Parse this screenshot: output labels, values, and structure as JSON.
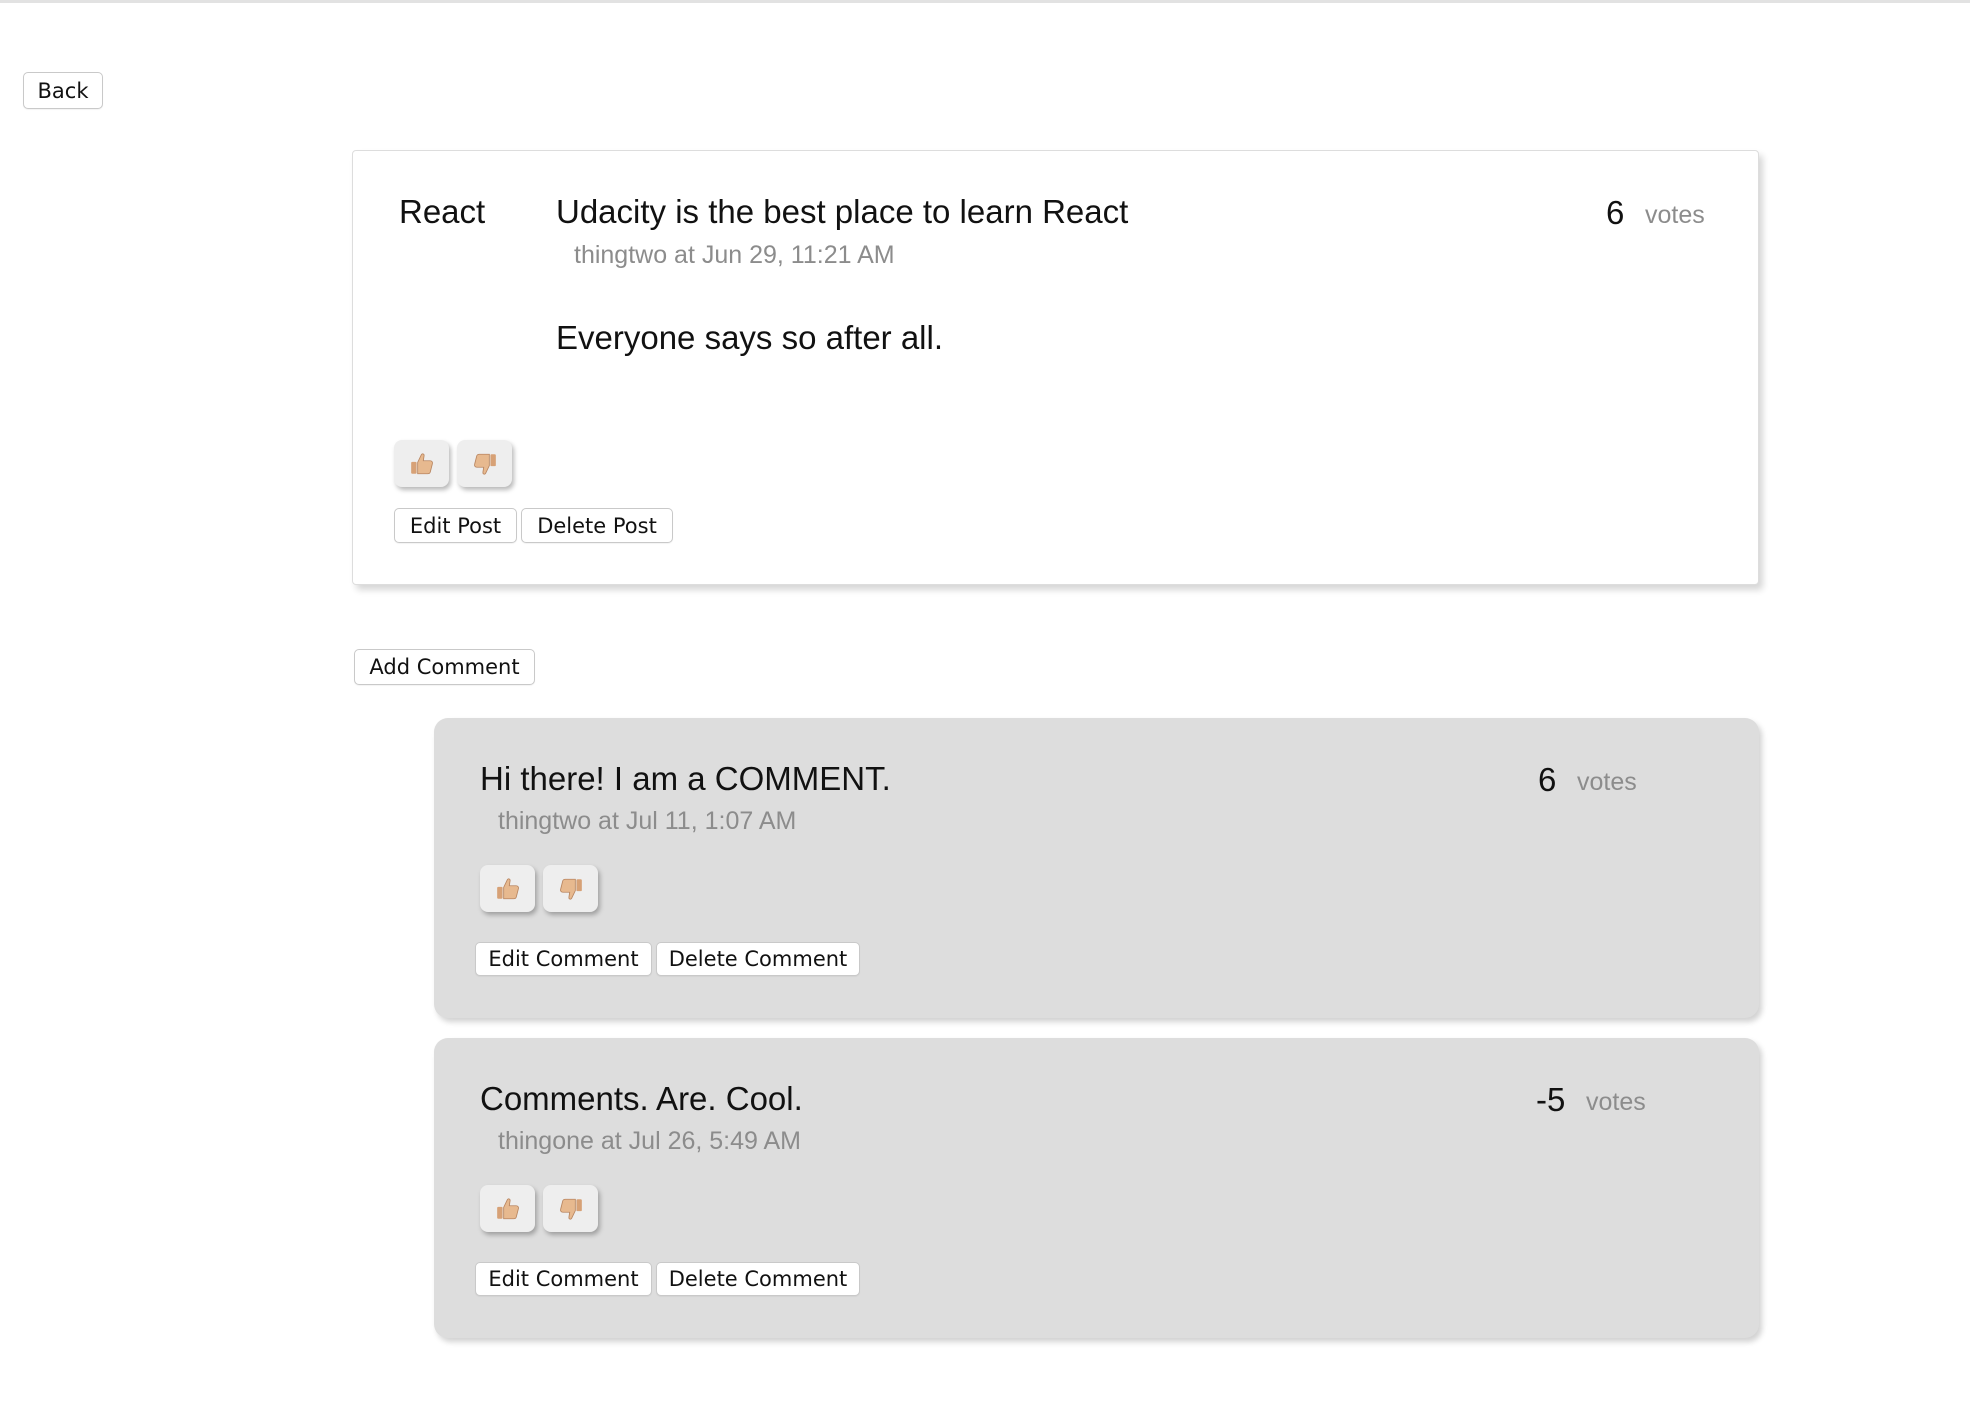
{
  "nav": {
    "back_label": "Back"
  },
  "post": {
    "category": "React",
    "title": "Udacity is the best place to learn React",
    "meta": "thingtwo at Jun 29, 11:21 AM",
    "body": "Everyone says so after all.",
    "vote_score": "6",
    "votes_label": "votes",
    "upvote_icon": "thumbs-up-icon",
    "downvote_icon": "thumbs-down-icon",
    "edit_label": "Edit Post",
    "delete_label": "Delete Post"
  },
  "add_comment_label": "Add Comment",
  "comments": [
    {
      "body": "Hi there! I am a COMMENT.",
      "meta": "thingtwo at Jul 11, 1:07 AM",
      "vote_score": "6",
      "votes_label": "votes",
      "edit_label": "Edit Comment",
      "delete_label": "Delete Comment"
    },
    {
      "body": "Comments. Are. Cool.",
      "meta": "thingone at Jul 26, 5:49 AM",
      "vote_score": "-5",
      "votes_label": "votes",
      "edit_label": "Edit Comment",
      "delete_label": "Delete Comment"
    }
  ],
  "colors": {
    "comment_bg": "#dddddd",
    "muted_text": "#8c8c8c",
    "thumb_skin": "#e7b98f"
  }
}
